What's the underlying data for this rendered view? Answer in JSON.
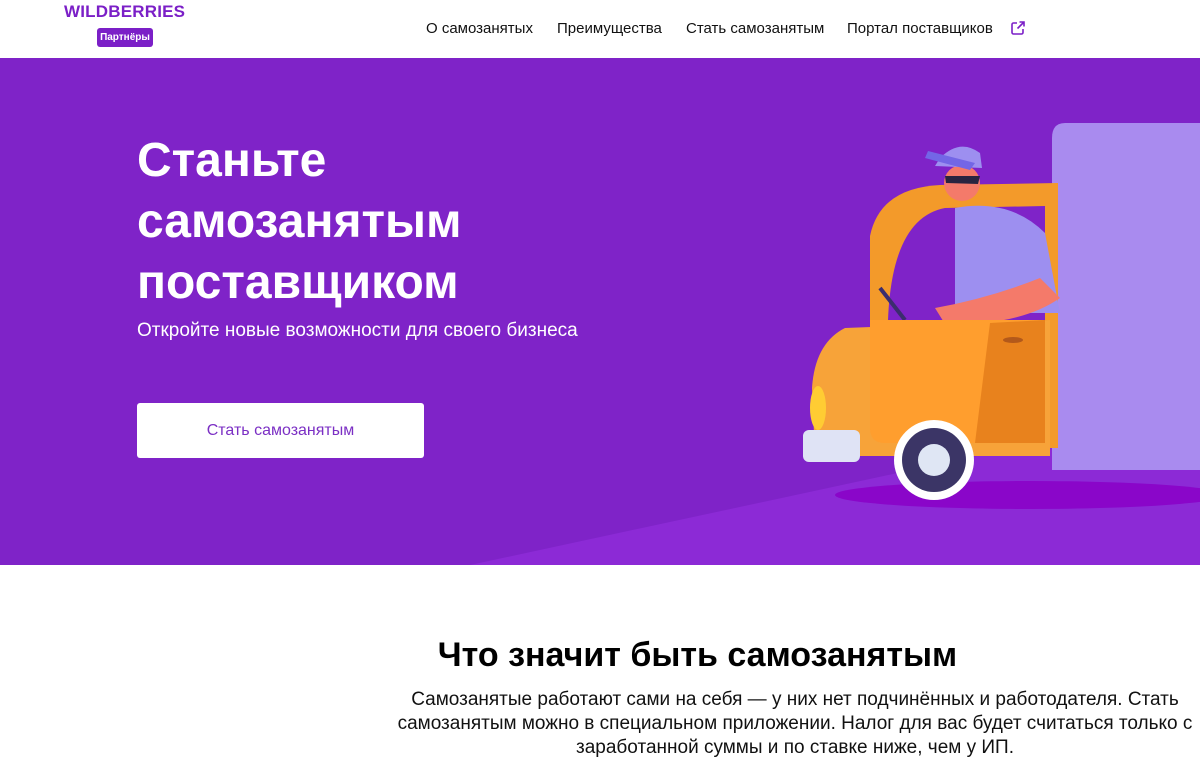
{
  "header": {
    "logo_text": "WILDBERRIES",
    "logo_badge": "Партнёры",
    "nav": [
      {
        "label": "О самозанятых"
      },
      {
        "label": "Преимущества"
      },
      {
        "label": "Стать самозанятым"
      },
      {
        "label": "Портал поставщиков"
      }
    ],
    "external_link_icon": "external-link-icon"
  },
  "hero": {
    "title": "Станьте самозанятым поставщиком",
    "subtitle": "Откройте новые возможности для своего бизнеса",
    "cta_label": "Стать самозанятым",
    "illustration": "delivery-truck-driver-illustration"
  },
  "section": {
    "title": "Что значит быть самозанятым",
    "text": "Самозанятые работают сами на себя — у них нет подчинённых и работодателя. Стать самозанятым можно в специальном приложении. Налог для вас будет считаться только с заработанной суммы и по ставке ниже, чем у ИП."
  },
  "colors": {
    "brand": "#7b1fc7",
    "hero_bg": "#7f23c8",
    "white": "#ffffff"
  }
}
